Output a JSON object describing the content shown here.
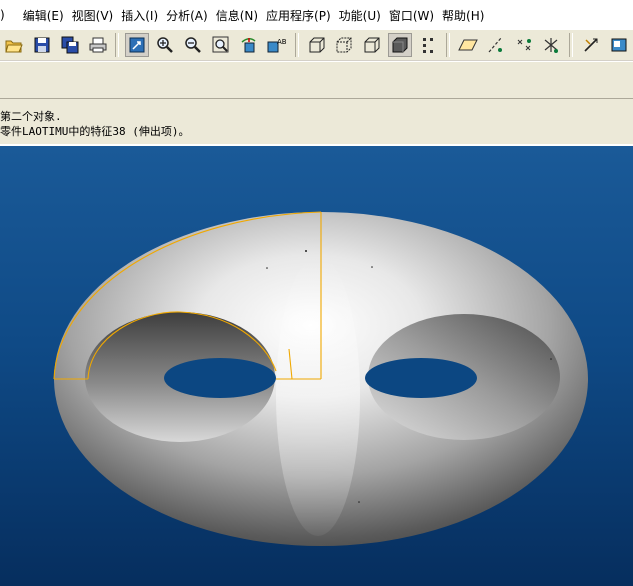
{
  "menu": {
    "items": [
      {
        "label": ")"
      },
      {
        "label": "编辑(E)"
      },
      {
        "label": "视图(V)"
      },
      {
        "label": "插入(I)"
      },
      {
        "label": "分析(A)"
      },
      {
        "label": "信息(N)"
      },
      {
        "label": "应用程序(P)"
      },
      {
        "label": "功能(U)"
      },
      {
        "label": "窗口(W)"
      },
      {
        "label": "帮助(H)"
      }
    ]
  },
  "toolbar": {
    "groups": [
      [
        "open-icon",
        "save-icon",
        "save-copy-icon",
        "print-icon"
      ],
      [
        "refit-icon",
        "zoom-in-icon",
        "zoom-out-icon",
        "zoom-window-icon",
        "spin-center-icon",
        "named-view-icon"
      ],
      [
        "wireframe-icon",
        "hidden-line-icon",
        "no-hidden-icon",
        "shading-icon",
        "datum-points-icon"
      ],
      [
        "datum-planes-icon",
        "datum-axes-icon",
        "point-display-icon",
        "coord-sys-icon"
      ],
      [
        "regenerate-icon",
        "model-tree-icon"
      ]
    ]
  },
  "messages": {
    "line1": "第二个对象.",
    "line2": "零件LAOTIMU中的特征38 (伸出项)。"
  },
  "colors": {
    "viewport_top": "#1a5a98",
    "viewport_bottom": "#062e5e",
    "highlight": "#f0a800"
  }
}
